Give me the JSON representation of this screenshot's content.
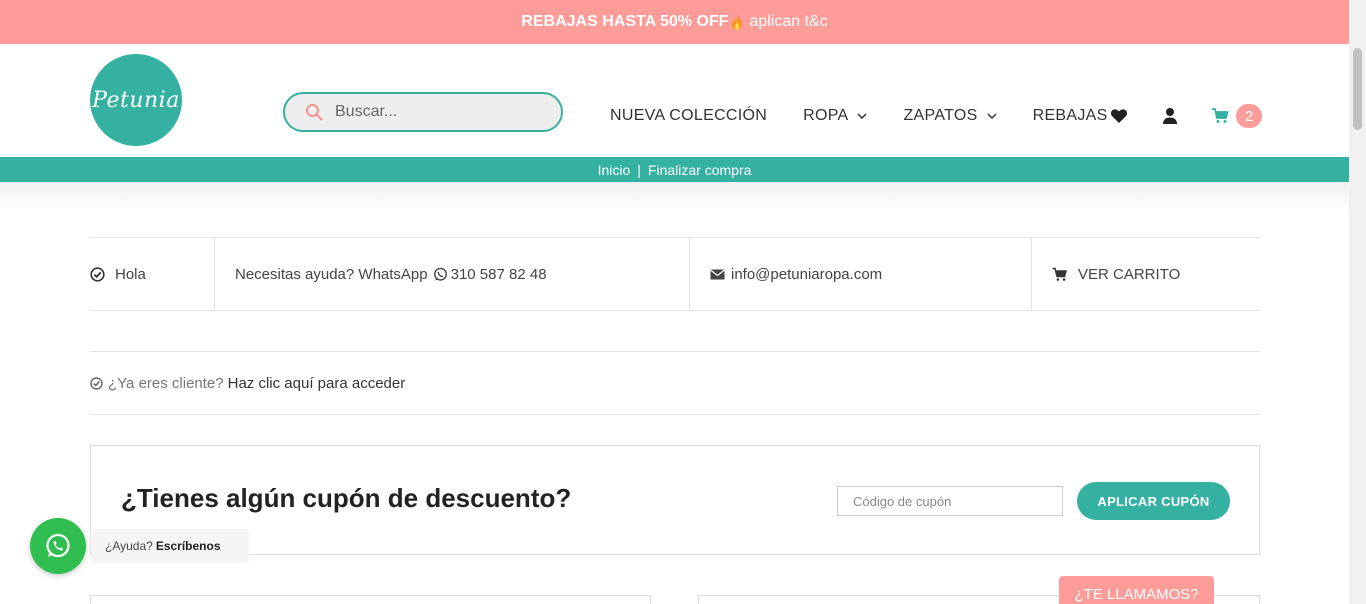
{
  "promo": {
    "bold": "REBAJAS HASTA 50% OFF",
    "rest": "aplican t&c"
  },
  "brand": {
    "logo_text": "Petunia"
  },
  "search": {
    "placeholder": "Buscar..."
  },
  "nav": {
    "items": [
      {
        "label": "NUEVA COLECCIÓN"
      },
      {
        "label": "ROPA"
      },
      {
        "label": "ZAPATOS"
      },
      {
        "label": "REBAJAS"
      }
    ],
    "cart_count": "2"
  },
  "breadcrumb": {
    "home": "Inicio",
    "separator": "|",
    "current": "Finalizar compra"
  },
  "infobar": {
    "greeting": "Hola",
    "help": "Necesitas ayuda? WhatsApp",
    "phone": "310 587 82 48",
    "email": "info@petuniaropa.com",
    "cart_link": "VER CARRITO"
  },
  "login_notice": {
    "question": "¿Ya eres cliente?",
    "link": "Haz clic aquí para acceder"
  },
  "coupon": {
    "title": "¿Tienes algún cupón de descuento?",
    "placeholder": "Código de cupón",
    "button": "APLICAR CUPÓN"
  },
  "whatsapp": {
    "question": "¿Ayuda?",
    "cta": "Escríbenos"
  },
  "callback": {
    "label": "¿TE LLAMAMOS?"
  },
  "colors": {
    "accent": "#34b1a1",
    "pink": "#fd9c98",
    "whatsapp": "#2fbe4f"
  }
}
